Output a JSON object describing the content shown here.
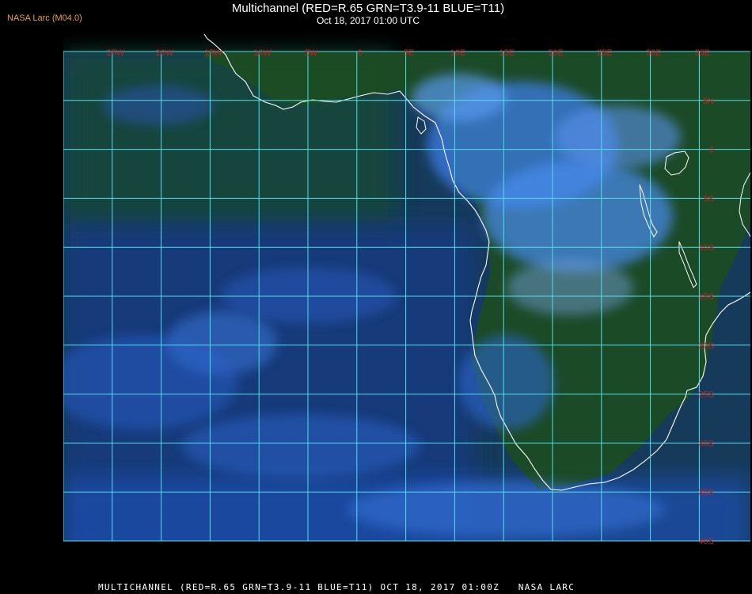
{
  "header": {
    "logo_text": "NASA Larc (M04.0)",
    "title": "Multichannel (RED=R.65 GRN=T3.9-11 BLUE=T11)",
    "subtitle": "Oct 18, 2017 01:00 UTC"
  },
  "footer": {
    "caption": "MULTICHANNEL (RED=R.65 GRN=T3.9-11 BLUE=T11) OCT 18, 2017 01:00Z   NASA LARC"
  },
  "map": {
    "longitude_labels": [
      "25W",
      "20W",
      "15W",
      "10W",
      "5W",
      "0",
      "5E",
      "10E",
      "15E",
      "20E",
      "25E",
      "30E",
      "35E"
    ],
    "latitude_labels": [
      "5N",
      "0",
      "5S",
      "10S",
      "15S",
      "20S",
      "25S",
      "30S",
      "35S",
      "40S"
    ],
    "colors": {
      "grid": "#4fe0ea",
      "label": "#c81e1e",
      "coast": "#ffffff",
      "ocean": "#0f2a70",
      "land": "#1f4a1f",
      "cloud": "#3a7ae8"
    }
  }
}
